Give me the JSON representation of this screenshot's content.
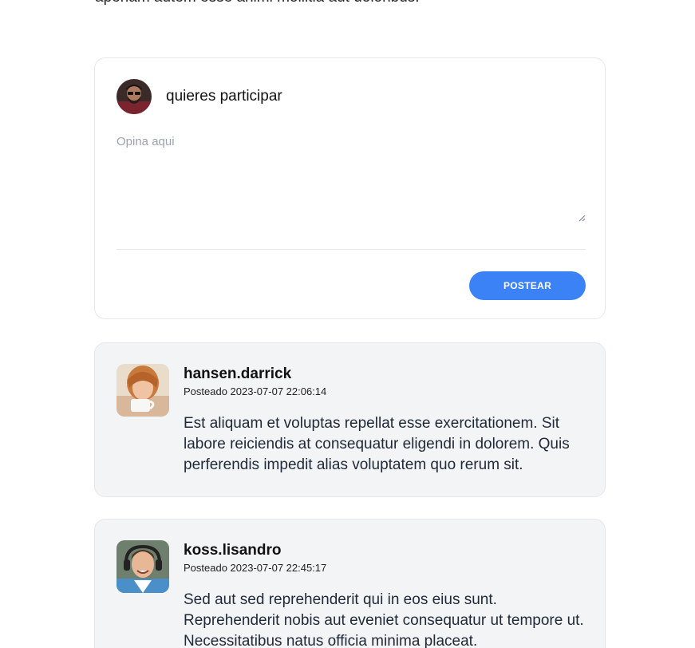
{
  "header": {
    "truncated_text": "aperiam autem esse animi mollitia aut doloribus."
  },
  "composer": {
    "title": "quieres participar",
    "placeholder": "Opina aqui",
    "post_button_label": "POSTEAR",
    "accent_color": "#3b82f6"
  },
  "posts": [
    {
      "user": "hansen.darrick",
      "date": "Posteado 2023-07-07 22:06:14",
      "body": "Est aliquam et voluptas repellat esse exercitationem. Sit labore reiciendis at consequatur eligendi in dolorem. Quis perferendis impedit alias voluptatem quo rerum sit."
    },
    {
      "user": "koss.lisandro",
      "date": "Posteado 2023-07-07 22:45:17",
      "body": "Sed aut sed reprehenderit qui in eos eius sunt. Reprehenderit nobis aut eveniet consequatur ut tempore ut. Necessitatibus natus officia minima placeat."
    }
  ]
}
